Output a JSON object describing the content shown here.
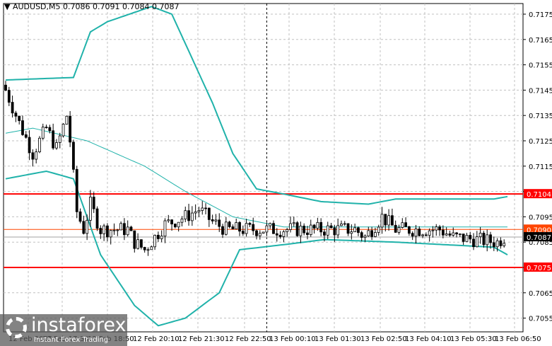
{
  "header": {
    "title": "AUDUSD,M5  0.7086 0.7091 0.7084 0.7087"
  },
  "watermark": {
    "brand": "instaforex",
    "tagline": "Instant Forex Trading"
  },
  "colors": {
    "band": "#20b2aa",
    "level": "#ff0000",
    "bid": "#ff4500",
    "current": "#000000",
    "bull": "#ffffff",
    "bear": "#000000"
  },
  "chart_data": {
    "type": "candlestick",
    "symbol": "AUDUSD",
    "timeframe": "M5",
    "ylim": [
      0.705,
      0.7182
    ],
    "y_ticks": [
      "0.7175",
      "0.7165",
      "0.7155",
      "0.7145",
      "0.7135",
      "0.7125",
      "0.7115",
      "0.7105",
      "0.7095",
      "0.7085",
      "0.7075",
      "0.7065",
      "0.7055"
    ],
    "x_ticks": [
      "12 Feb 2025",
      "12 Feb 17:30",
      "12 Feb 18:50",
      "12 Feb 20:10",
      "12 Feb 21:30",
      "12 Feb 22:50",
      "13 Feb 00:10",
      "13 Feb 01:30",
      "13 Feb 02:50",
      "13 Feb 04:10",
      "13 Feb 05:30",
      "13 Feb 06:50"
    ],
    "bars": 148,
    "close_path": [
      [
        0,
        0.7145
      ],
      [
        4,
        0.7132
      ],
      [
        8,
        0.712
      ],
      [
        12,
        0.713
      ],
      [
        15,
        0.7122
      ],
      [
        18,
        0.7135
      ],
      [
        19,
        0.7125
      ],
      [
        21,
        0.7097
      ],
      [
        23,
        0.709
      ],
      [
        25,
        0.71
      ],
      [
        28,
        0.709
      ],
      [
        36,
        0.709
      ],
      [
        38,
        0.7085
      ],
      [
        41,
        0.7082
      ],
      [
        47,
        0.7092
      ],
      [
        53,
        0.7095
      ],
      [
        57,
        0.7098
      ],
      [
        61,
        0.7093
      ],
      [
        65,
        0.709
      ],
      [
        103,
        0.709
      ],
      [
        106,
        0.7087
      ],
      [
        111,
        0.7095
      ],
      [
        115,
        0.709
      ],
      [
        128,
        0.709
      ],
      [
        132,
        0.7087
      ],
      [
        145,
        0.7085
      ],
      [
        147,
        0.7087
      ]
    ],
    "upper_band": [
      [
        0,
        0.7149
      ],
      [
        20,
        0.715
      ],
      [
        25,
        0.7168
      ],
      [
        30,
        0.7172
      ],
      [
        43,
        0.7178
      ],
      [
        49,
        0.7175
      ],
      [
        61,
        0.714
      ],
      [
        67,
        0.712
      ],
      [
        74,
        0.7106
      ],
      [
        82,
        0.7104
      ],
      [
        93,
        0.7101
      ],
      [
        107,
        0.71
      ],
      [
        115,
        0.7102
      ],
      [
        144,
        0.7102
      ],
      [
        148,
        0.7103
      ]
    ],
    "middle_band": [
      [
        0,
        0.7128
      ],
      [
        8,
        0.713
      ],
      [
        24,
        0.7125
      ],
      [
        41,
        0.7115
      ],
      [
        53,
        0.7105
      ],
      [
        67,
        0.7095
      ],
      [
        82,
        0.7091
      ],
      [
        148,
        0.7091
      ]
    ],
    "lower_band": [
      [
        0,
        0.711
      ],
      [
        12,
        0.7113
      ],
      [
        20,
        0.711
      ],
      [
        28,
        0.708
      ],
      [
        38,
        0.706
      ],
      [
        45,
        0.7052
      ],
      [
        53,
        0.7055
      ],
      [
        63,
        0.7065
      ],
      [
        69,
        0.7082
      ],
      [
        82,
        0.7084
      ],
      [
        94,
        0.7086
      ],
      [
        115,
        0.7085
      ],
      [
        144,
        0.7083
      ],
      [
        148,
        0.708
      ]
    ],
    "levels": [
      {
        "price": 0.7104,
        "label": "0.7104",
        "kind": "resistance"
      },
      {
        "price": 0.7075,
        "label": "0.7075",
        "kind": "support"
      },
      {
        "price": 0.709,
        "label": "0.7090",
        "kind": "ask"
      },
      {
        "price": 0.7087,
        "label": "0.7087",
        "kind": "current"
      }
    ],
    "session_separator_bar": 77
  }
}
